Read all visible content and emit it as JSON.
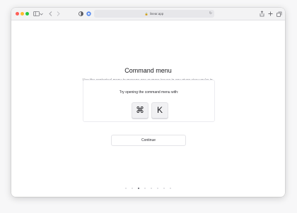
{
  "browser": {
    "url": "linear.app",
    "colors": {
      "close": "#ff5f57",
      "minimize": "#febc2e",
      "zoom": "#28c840"
    },
    "icons": [
      "sidebar-icon",
      "chevron-down-icon",
      "back-icon",
      "forward-icon",
      "shield-icon",
      "extension-icon",
      "lock-icon",
      "reload-icon",
      "share-icon",
      "new-tab-icon",
      "tabs-icon"
    ]
  },
  "main": {
    "title": "Command menu",
    "subtitle": "Use the contextual menu to manage one or more issues in any given view you're in.",
    "demo": {
      "label": "Try opening the command menu with:",
      "keys": [
        "⌘",
        "K"
      ]
    },
    "continue_label": "Continue"
  },
  "pagination": {
    "total": 8,
    "current": 3
  }
}
